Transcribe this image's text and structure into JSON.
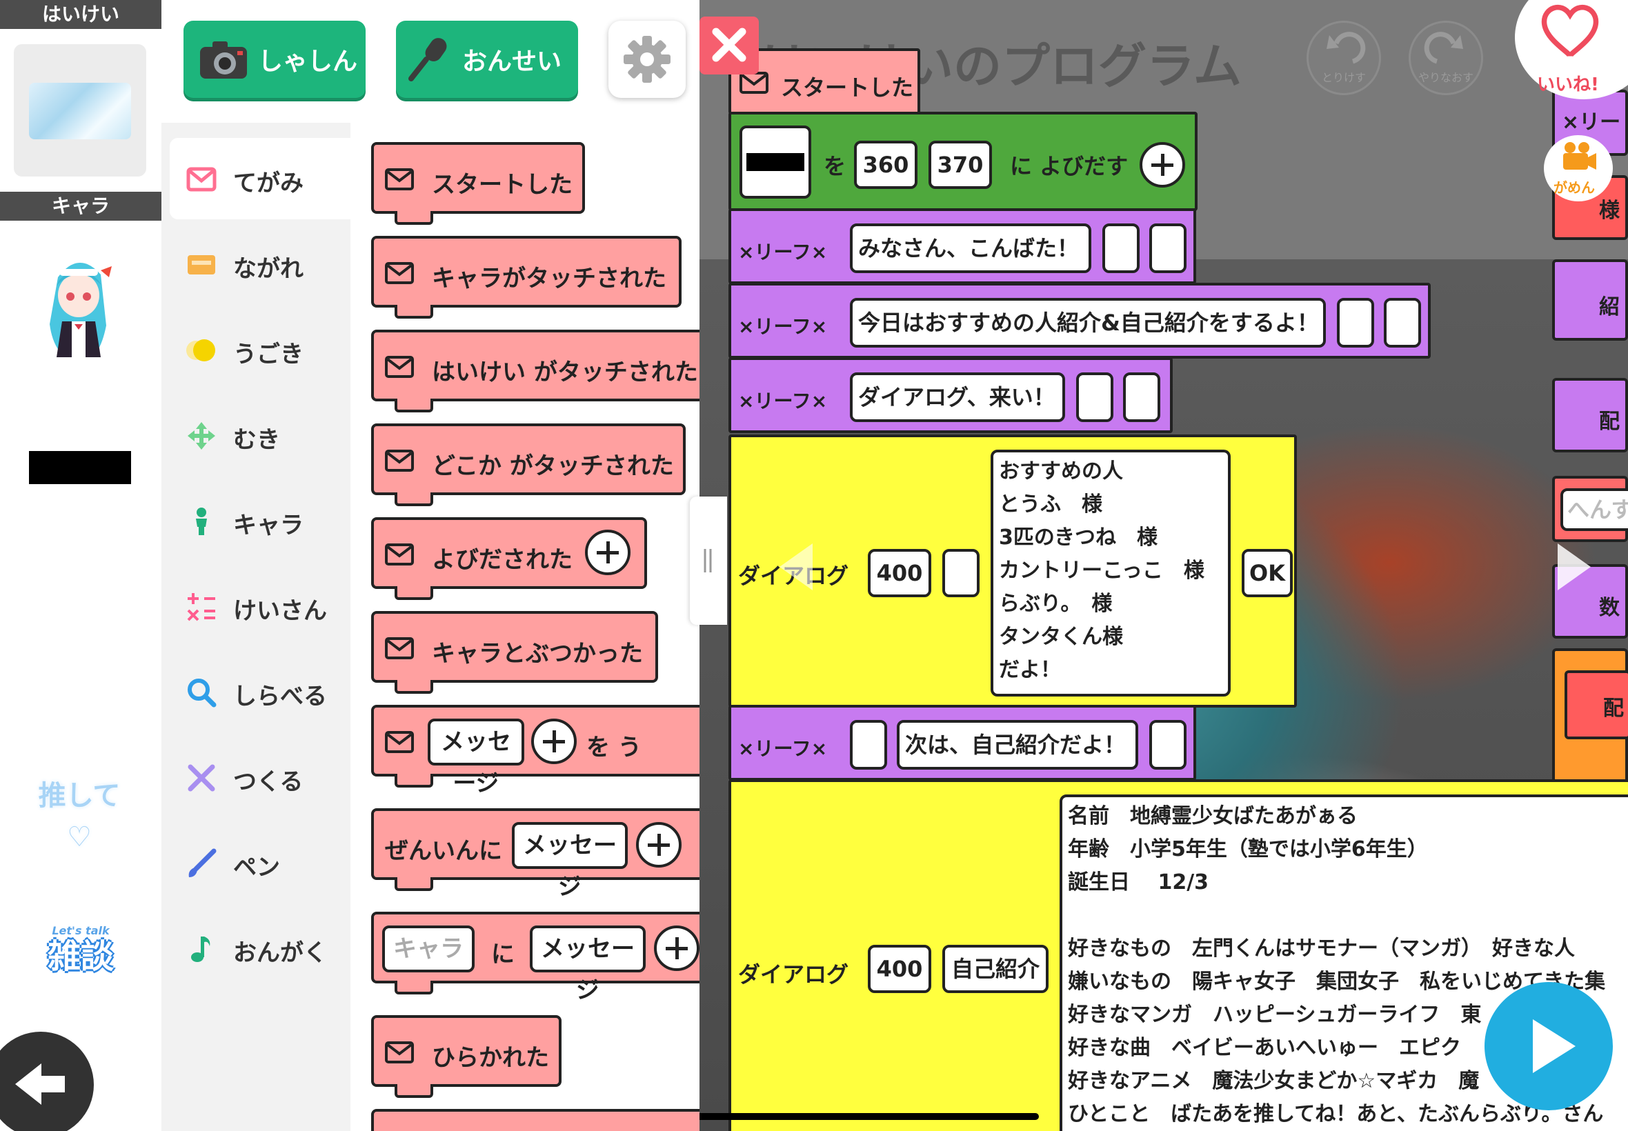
{
  "assets": {
    "background_header": "はいけい",
    "chara_header": "キャラ",
    "sticker_oshite": "推して♡",
    "sticker_zatsudan_en": "Let's talk",
    "sticker_zatsudan_jp": "雑談"
  },
  "toolbar": {
    "photo_label": "しゃしん",
    "sound_label": "おんせい"
  },
  "categories": [
    {
      "label": "てがみ",
      "icon": "envelope-icon",
      "color": "#ff6f91",
      "active": true
    },
    {
      "label": "ながれ",
      "icon": "flow-icon",
      "color": "#f7b24a",
      "active": false
    },
    {
      "label": "うごき",
      "icon": "motion-icon",
      "color": "#f5d400",
      "active": false
    },
    {
      "label": "むき",
      "icon": "direction-icon",
      "color": "#6ed38c",
      "active": false
    },
    {
      "label": "キャラ",
      "icon": "person-icon",
      "color": "#22b07d",
      "active": false
    },
    {
      "label": "けいさん",
      "icon": "calc-icon",
      "color": "#ff5d8f",
      "active": false
    },
    {
      "label": "しらべる",
      "icon": "search-icon",
      "color": "#2f9ee8",
      "active": false
    },
    {
      "label": "つくる",
      "icon": "tools-icon",
      "color": "#a88ff0",
      "active": false
    },
    {
      "label": "ペン",
      "icon": "pen-icon",
      "color": "#4b6fe0",
      "active": false
    },
    {
      "label": "おんがく",
      "icon": "music-note-icon",
      "color": "#22b07d",
      "active": false
    }
  ],
  "palette_blocks": {
    "start": "スタートした",
    "chara_touched": "キャラがタッチされた",
    "bg_touched": "はいけい がタッチされた",
    "anywhere_touched": "どこか がタッチされた",
    "called": "よびだされた",
    "hit_chara": "キャラとぶつかった",
    "message_pill": "メッセージ",
    "message_suffix": "を う",
    "everyone_prefix": "ぜんいんに",
    "everyone_message": "メッセージ",
    "chara_pill": "キャラ",
    "ni": "に",
    "chara_message": "メッセージ",
    "opened": "ひらかれた"
  },
  "editor": {
    "program_title": "はいけいのプログラム",
    "undo_label": "とりけす",
    "redo_label": "やりなおす",
    "like_label": "いいね!",
    "screen_label": "がめん",
    "start_block": "スタートした",
    "call_block": {
      "wo": "を",
      "x": "360",
      "y": "370",
      "suffix": "に よびだす"
    },
    "leaf_label": "×リーフ×",
    "leaf1_text": "みなさん、こんばた！",
    "leaf2_text": "今日はおすすめの人紹介&自己紹介をするよ！",
    "leaf3_text": "ダイアログ、来い！",
    "dialog_label": "ダイアログ",
    "dialog1_width": "400",
    "dialog1_text": "おすすめの人\nとうふ　様\n3匹のきつね　様\nカントリーこっこ　様\nらぶり。　様\nタンタくん様\nだよ！",
    "dialog1_ok": "OK",
    "leaf4_text": "次は、自己紹介だよ！",
    "dialog2_width": "400",
    "dialog2_title": "自己紹介",
    "dialog2_text": "名前　地縛霊少女ばたあがぁる\n年齢　小学5年生（塾では小学6年生）\n誕生日　 12/3\n\n好きなもの　左門くんはサモナー（マンガ）　好きな人\n嫌いなもの　陽キャ女子　集団女子　私をいじめてきた集\n好きなマンガ　ハッピーシュガーライフ　東\n好きな曲　ベイビーあいへいゅー　エピク\n好きなアニメ　魔法少女まどか☆マギカ　魔\nひとこと　ばたあを推してね！あと、たぶんらぶり。さん",
    "right_input_placeholder": "へんす",
    "right_stack_labels": [
      "×リーフ",
      "様",
      "紹",
      "配",
      "数",
      "配"
    ]
  },
  "colors": {
    "accent_green": "#1db57c",
    "block_pink": "#ffa0a0",
    "block_purple": "#c77af0",
    "block_yellow": "#ffff3e",
    "block_green": "#4fa83d",
    "close_red": "#f65f6f",
    "play_blue": "#21aee0"
  }
}
